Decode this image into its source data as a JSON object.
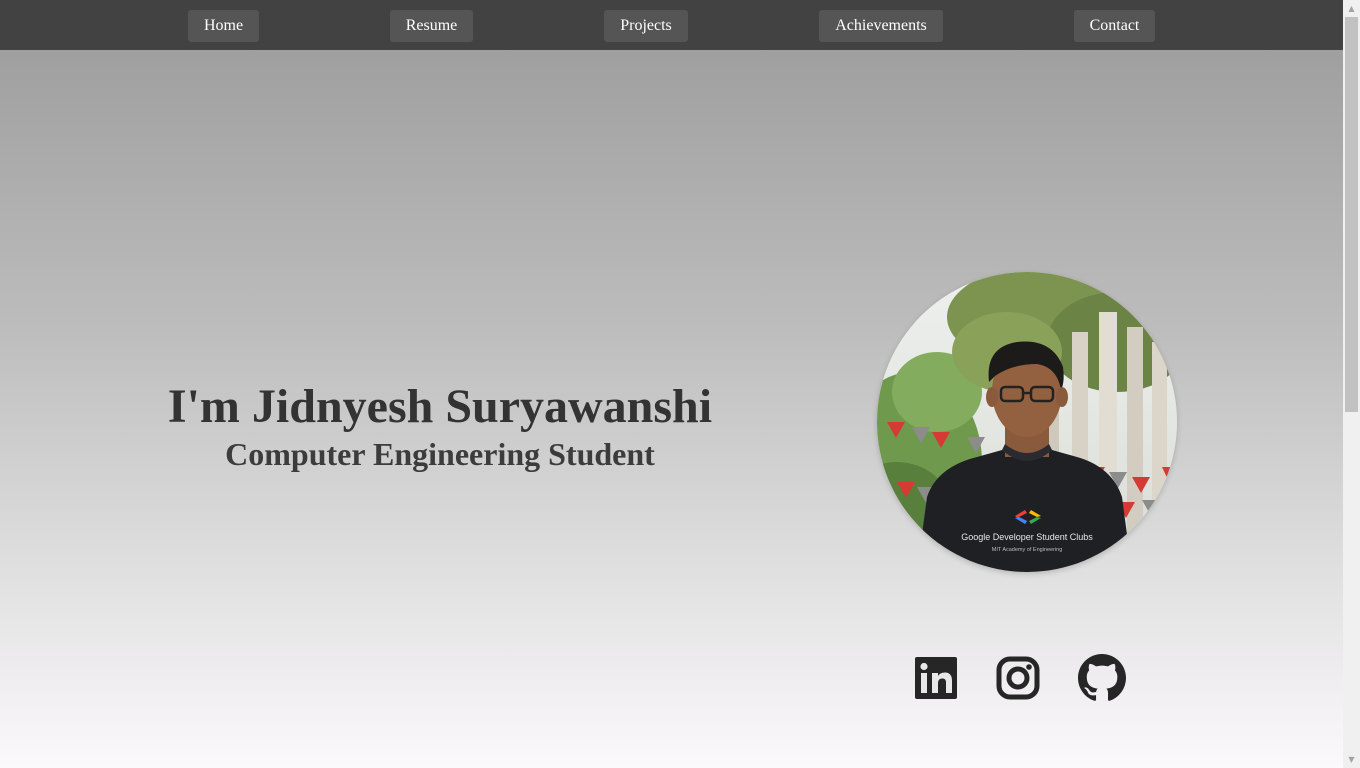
{
  "nav": {
    "items": [
      {
        "label": "Home"
      },
      {
        "label": "Resume"
      },
      {
        "label": "Projects"
      },
      {
        "label": "Achievements"
      },
      {
        "label": "Contact"
      }
    ]
  },
  "hero": {
    "name": "I'm Jidnyesh Suryawanshi",
    "role": "Computer Engineering Student",
    "photo": {
      "shirt_logo_text": "Google Developer Student Clubs",
      "shirt_subtext": "MIT Academy of Engineering"
    }
  },
  "social": {
    "icons": [
      "linkedin-icon",
      "instagram-icon",
      "github-icon"
    ],
    "icon_color": "#262626"
  },
  "colors": {
    "navbar": "#424242",
    "nav_button": "#555555",
    "text": "#333333"
  },
  "scrollbar": {
    "up_arrow": "▲",
    "down_arrow": "▼"
  }
}
